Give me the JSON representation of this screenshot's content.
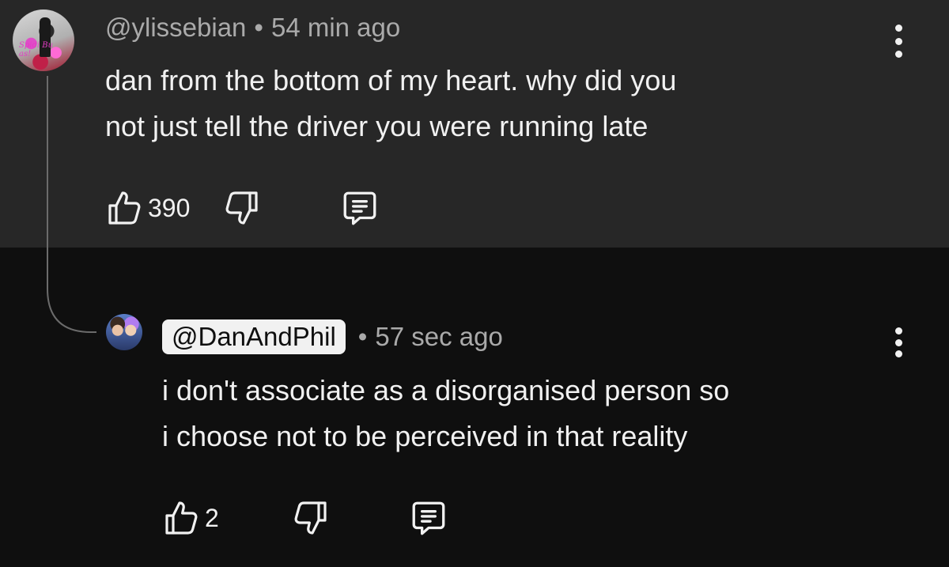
{
  "comment": {
    "author": "@ylissebian",
    "separator": "•",
    "time": "54 min ago",
    "text_line1": "dan from the bottom of my heart. why did you",
    "text_line2": "not just tell the driver you were running late",
    "likes": "390",
    "avatar_scribble": "Spidi Bu as!"
  },
  "reply": {
    "author": "@DanAndPhil",
    "separator": "•",
    "time": "57 sec ago",
    "text_line1": "i don't associate as a disorganised person so",
    "text_line2": "i choose not to be perceived in that reality",
    "likes": "2"
  },
  "colors": {
    "top_background": "#272727",
    "reply_background": "#0f0f0f",
    "primary_text": "#f1f1f1",
    "secondary_text": "#aaaaaa",
    "thread_line": "#6b6b6b"
  }
}
